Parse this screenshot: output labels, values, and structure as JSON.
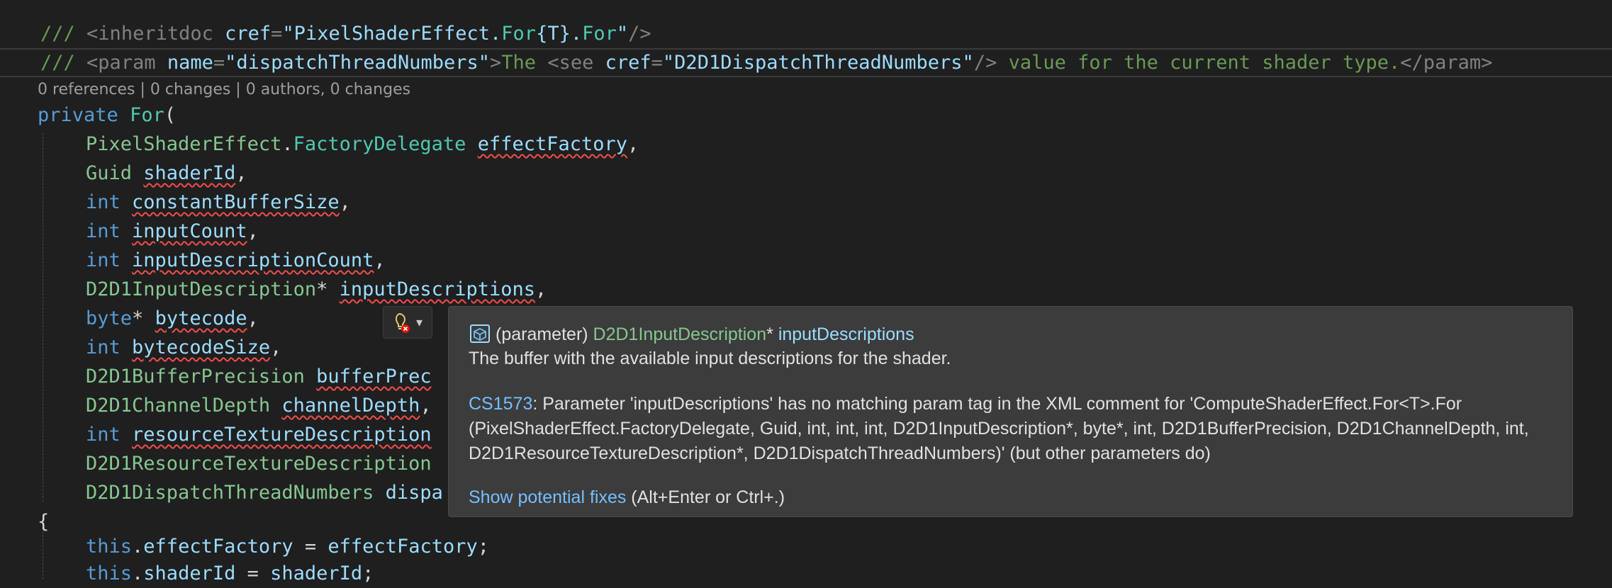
{
  "doc": {
    "line1": {
      "slashes": "///",
      "open": "<inheritdoc",
      "attr": "cref",
      "eq": "=",
      "val1": "\"PixelShaderEffect.",
      "val2": "For",
      "val3": "{T}",
      "val4": ".",
      "val5": "For",
      "val6": "\"",
      "close": "/>"
    },
    "line2": {
      "slashes": "///",
      "open": "<param",
      "attr": "name",
      "eq": "=",
      "val": "\"dispatchThreadNumbers\"",
      "gt": ">",
      "text1": "The ",
      "see": "<see",
      "cref": "cref",
      "eq2": "=",
      "crefval": "\"D2D1DispatchThreadNumbers\"",
      "seeclose": "/>",
      "text2": " value for the current shader type.",
      "end": "</param>"
    }
  },
  "codelens": "0 references | 0 changes | 0 authors, 0 changes",
  "code": {
    "private": "private",
    "for": "For",
    "paren": "(",
    "p1_type_a": "PixelShaderEffect",
    "p1_dot": ".",
    "p1_type_b": "FactoryDelegate",
    "p1_name": "effectFactory",
    "p2_type": "Guid",
    "p2_name": "shaderId",
    "p3_type": "int",
    "p3_name": "constantBufferSize",
    "p4_type": "int",
    "p4_name": "inputCount",
    "p5_type": "int",
    "p5_name": "inputDescriptionCount",
    "p6_type": "D2D1InputDescription",
    "p6_star": "*",
    "p6_name": "inputDescriptions",
    "p7_type": "byte",
    "p7_star": "*",
    "p7_name": "bytecode",
    "p8_type": "int",
    "p8_name": "bytecodeSize",
    "p9_type": "D2D1BufferPrecision",
    "p9_name": "bufferPrec",
    "p10_type": "D2D1ChannelDepth",
    "p10_name": "channelDepth",
    "p11_type": "int",
    "p11_name": "resourceTextureDescription",
    "p12_type": "D2D1ResourceTextureDescription",
    "p13_type": "D2D1DispatchThreadNumbers",
    "p13_name": "dispa",
    "comma": ",",
    "brace": "{",
    "this": "this",
    "dot": ".",
    "assign1_field": "effectFactory",
    "assign1_eq": " = ",
    "assign1_val": "effectFactory",
    "semi": ";",
    "assign2_field": "shaderId",
    "assign2_val": "shaderId"
  },
  "tooltip": {
    "kind": "(parameter)",
    "type": "D2D1InputDescription",
    "star": "*",
    "name": "inputDescriptions",
    "summary": "The buffer with the available input descriptions for the shader.",
    "error_code": "CS1573",
    "error_text": ": Parameter 'inputDescriptions' has no matching param tag in the XML comment for 'ComputeShaderEffect.For<T>.For (PixelShaderEffect.FactoryDelegate, Guid, int, int, int, D2D1InputDescription*, byte*, int, D2D1BufferPrecision, D2D1ChannelDepth, int, D2D1ResourceTextureDescription*, D2D1DispatchThreadNumbers)' (but other parameters do)",
    "fix_link": "Show potential fixes",
    "fix_shortcut": " (Alt+Enter or Ctrl+.)"
  },
  "colors": {
    "background": "#1f1f1f",
    "tooltip_bg": "#3c3c3c",
    "link": "#75beff",
    "error": "#f14c4c"
  },
  "icons": {
    "param": "parameter-cube-icon",
    "bulb": "lightbulb-error-icon",
    "dropdown": "chevron-down-icon"
  }
}
